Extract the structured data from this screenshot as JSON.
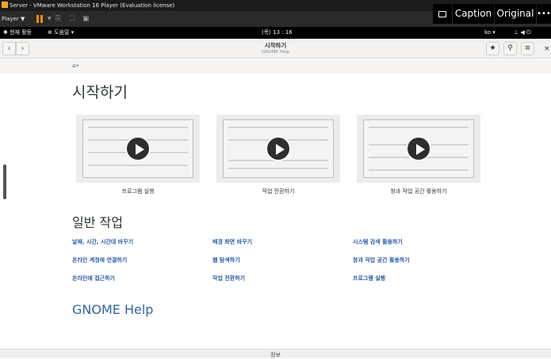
{
  "vmware": {
    "title": "Server - VMware Workstation 16 Player (Evaluation license)",
    "player_menu": "Player ▼",
    "accent": "#f08c00"
  },
  "overlay": {
    "caption": "Caption",
    "original": "Original",
    "more": "•••"
  },
  "panel": {
    "activities": "현재 활동",
    "places": "도움말 ▾",
    "clock": "(목) 13 : 16",
    "input_method": "ko ▾"
  },
  "headerbar": {
    "title": "시작하기",
    "subtitle": "GNOME Help"
  },
  "page": {
    "title": "시작하기",
    "videos": [
      {
        "caption": "프로그램 실행"
      },
      {
        "caption": "작업 전환하기"
      },
      {
        "caption": "창과 작업 공간 활용하기"
      }
    ],
    "section_title": "일반 작업",
    "topics": [
      [
        "날짜, 시간, 시간대 바꾸기",
        "배경 화면 바꾸기",
        "시스템 검색 활용하기"
      ],
      [
        "온라인 계정에 연결하기",
        "웹 탐색하기",
        "창과 작업 공간 활용하기"
      ],
      [
        "온라인에 접근하기",
        "작업 전환하기",
        "프로그램 실행"
      ]
    ],
    "help_link": "GNOME Help",
    "footer": "정보"
  },
  "colors": {
    "link": "#2a5aa8",
    "help_link": "#3465a4"
  }
}
